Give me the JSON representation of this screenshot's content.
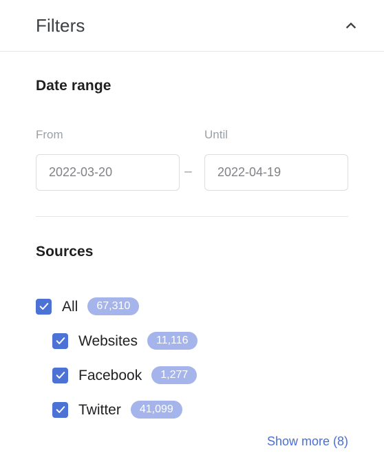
{
  "panel": {
    "title": "Filters",
    "collapse_icon": "chevron-up-icon"
  },
  "date_range": {
    "heading": "Date range",
    "from_label": "From",
    "until_label": "Until",
    "from_value": "2022-03-20",
    "until_value": "2022-04-19",
    "separator": "–"
  },
  "sources": {
    "heading": "Sources",
    "items": [
      {
        "label": "All",
        "count": "67,310",
        "checked": true,
        "indent": false
      },
      {
        "label": "Websites",
        "count": "11,116",
        "checked": true,
        "indent": true
      },
      {
        "label": "Facebook",
        "count": "1,277",
        "checked": true,
        "indent": true
      },
      {
        "label": "Twitter",
        "count": "41,099",
        "checked": true,
        "indent": true
      }
    ],
    "show_more_label": "Show more (8)"
  },
  "colors": {
    "accent": "#4c72d6",
    "badge": "#a5b4ea",
    "link": "#4a6fd4",
    "divider": "#e6e6e6",
    "heading_text": "#1f1f1f",
    "muted_text": "#9aa0a6"
  }
}
